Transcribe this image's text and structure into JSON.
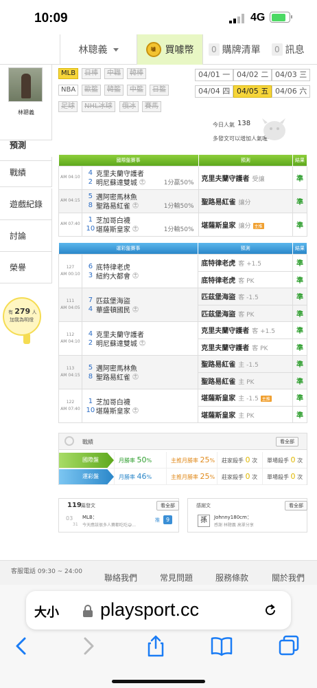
{
  "status": {
    "time": "10:09",
    "network": "4G"
  },
  "topnav": {
    "user": "林聰義",
    "buy": "買噱幣",
    "coin_text": "噱",
    "cart_count": "0",
    "cart": "購牌清單",
    "msg_count": "0",
    "messages": "訊息"
  },
  "sidebar": {
    "avatar_name": "林聰義",
    "items": [
      {
        "label": "預測"
      },
      {
        "label": "戰績"
      },
      {
        "label": "遊戲紀錄"
      },
      {
        "label": "討論"
      },
      {
        "label": "榮譽"
      }
    ],
    "popular_prefix": "有",
    "popular_count": "279",
    "popular_suffix": "人",
    "popular_line2": "加我為明燈"
  },
  "leagues_row1": [
    "MLB",
    "日棒",
    "中職",
    "韓棒"
  ],
  "leagues_row2": [
    "NBA",
    "歐籃",
    "韓籃",
    "中籃",
    "日籃"
  ],
  "leagues_row3": [
    "足球",
    "NHL冰球",
    "俄冰",
    "賽馬"
  ],
  "dates": [
    "04/01 一",
    "04/02 二",
    "04/03 三",
    "04/04 四",
    "04/05 五",
    "04/06 六"
  ],
  "today_pop_label": "今日人氣",
  "today_pop_value": "138",
  "today_pop_hint": "多發文可以增加人氣喔→",
  "intl_table": {
    "headers": [
      "國際盤賽事",
      "預測",
      "結果"
    ],
    "rows": [
      {
        "time": "AM 04:10",
        "t1n": "4",
        "t1": "克里夫蘭守護者",
        "t2n": "2",
        "t2": "明尼蘇達雙城",
        "home": "主",
        "rate": "1分贏50%",
        "pick": "克里夫蘭守護者",
        "pick_sub": "受讓",
        "tag": "",
        "result": "準"
      },
      {
        "time": "AM 04:15",
        "t1n": "5",
        "t1": "邁阿密馬林魚",
        "t2n": "8",
        "t2": "聖路易紅雀",
        "home": "主",
        "rate": "1分輸50%",
        "pick": "聖路易紅雀",
        "pick_sub": "讓分",
        "tag": "",
        "result": "準"
      },
      {
        "time": "AM 07:40",
        "t1n": "1",
        "t1": "芝加哥白襪",
        "t2n": "10",
        "t2": "堪薩斯皇家",
        "home": "主",
        "rate": "1分輸50%",
        "pick": "堪薩斯皇家",
        "pick_sub": "讓分",
        "tag": "主推",
        "result": "準"
      }
    ]
  },
  "lottery_table": {
    "headers": [
      "運彩盤賽事",
      "預測",
      "結果"
    ],
    "rows": [
      {
        "no": "127",
        "time": "AM 00:10",
        "t1n": "6",
        "t1": "底特律老虎",
        "t2n": "3",
        "t2": "紐約大都會",
        "home": "主",
        "p1": "底特律老虎",
        "p1s": "客 +1.5",
        "p1tag": "",
        "r1": "準",
        "p2": "底特律老虎",
        "p2s": "客 PK",
        "r2": "準"
      },
      {
        "no": "111",
        "time": "AM 04:05",
        "t1n": "7",
        "t1": "匹茲堡海盜",
        "t2n": "4",
        "t2": "華盛頓國民",
        "home": "主",
        "p1": "匹茲堡海盜",
        "p1s": "客 -1.5",
        "p1tag": "",
        "r1": "準",
        "p2": "匹茲堡海盜",
        "p2s": "客 PK",
        "r2": "準"
      },
      {
        "no": "112",
        "time": "AM 04:10",
        "t1n": "4",
        "t1": "克里夫蘭守護者",
        "t2n": "2",
        "t2": "明尼蘇達雙城",
        "home": "主",
        "p1": "克里夫蘭守護者",
        "p1s": "客 +1.5",
        "p1tag": "",
        "r1": "準",
        "p2": "克里夫蘭守護者",
        "p2s": "客 PK",
        "r2": "準"
      },
      {
        "no": "113",
        "time": "AM 04:15",
        "t1n": "5",
        "t1": "邁阿密馬林魚",
        "t2n": "8",
        "t2": "聖路易紅雀",
        "home": "主",
        "p1": "聖路易紅雀",
        "p1s": "主 -1.5",
        "p1tag": "",
        "r1": "準",
        "p2": "聖路易紅雀",
        "p2s": "主 PK",
        "r2": "準"
      },
      {
        "no": "122",
        "time": "AM 07:40",
        "t1n": "1",
        "t1": "芝加哥白襪",
        "t2n": "10",
        "t2": "堪薩斯皇家",
        "home": "主",
        "p1": "堪薩斯皇家",
        "p1s": "主 -1.5",
        "p1tag": "主推",
        "r1": "準",
        "p2": "堪薩斯皇家",
        "p2s": "主 PK",
        "r2": "準"
      }
    ]
  },
  "record": {
    "title": "戰績",
    "all": "看全部",
    "intl_label": "國際盤",
    "lottery_label": "運彩盤",
    "intl": {
      "month_rate_label": "月勝率",
      "month_rate": "50",
      "main_rate_label": "主推月勝率",
      "main_rate": "25",
      "banker_label": "莊家殺手",
      "banker": "0",
      "single_label": "單場殺手",
      "single": "0",
      "unit_pct": "%",
      "unit_times": "次"
    },
    "lottery": {
      "month_rate_label": "月勝率",
      "month_rate": "46",
      "main_rate_label": "主推月勝率",
      "main_rate": "25",
      "banker_label": "莊家殺手",
      "banker": "0",
      "single_label": "單場殺手",
      "single": "0",
      "unit_pct": "%",
      "unit_times": "次"
    }
  },
  "posts": {
    "count": "119",
    "label": "篇發文",
    "all": "看全部",
    "date_top": "03",
    "date_bottom": "31",
    "title": "MLB：",
    "preview": "今天應該很多人賽都吃吃😅...",
    "push": "推",
    "push_count": "9"
  },
  "thanks": {
    "label": "感謝文",
    "all": "看全部",
    "avatar_char": "孫",
    "user": "Johnny180cm：",
    "text": "感謝 林聰義 高單分享"
  },
  "footer": {
    "phone": "客服電話 09:30 ~ 24:00",
    "links": [
      "聯絡我們",
      "常見問題",
      "服務條款",
      "關於我們"
    ]
  },
  "safari": {
    "aa": "大小",
    "host": "playsport.cc"
  },
  "colors": {
    "green": "#5ea81d",
    "blue": "#2b87c9",
    "yellow": "#f6d53a",
    "win": "#2e9e2e",
    "team_num": "#2b6cc4"
  }
}
